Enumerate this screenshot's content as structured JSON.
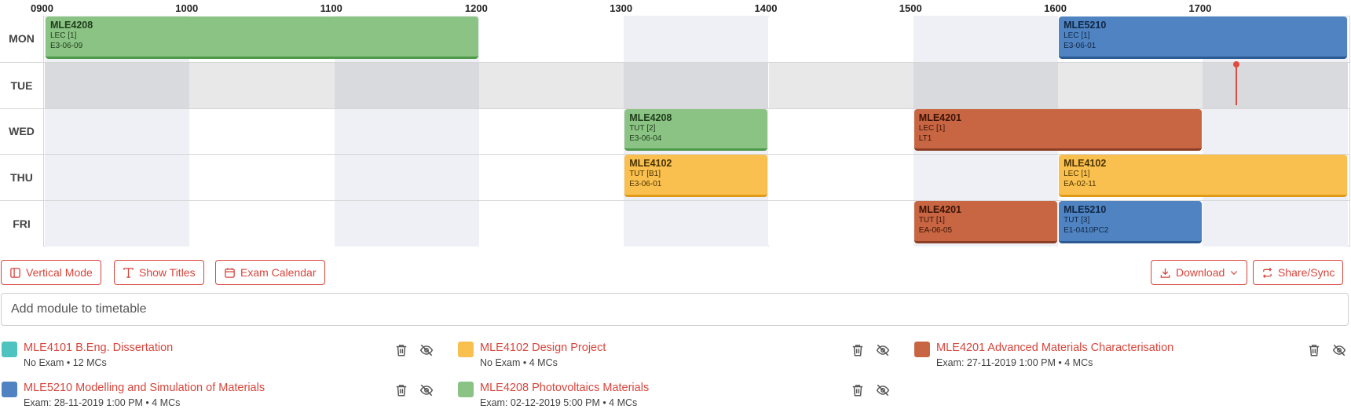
{
  "hours": [
    "0900",
    "1000",
    "1100",
    "1200",
    "1300",
    "1400",
    "1500",
    "1600",
    "1700"
  ],
  "days": [
    "MON",
    "TUE",
    "WED",
    "THU",
    "FRI"
  ],
  "colors": {
    "green": {
      "bg": "#8bc384",
      "border": "#4f9a4a",
      "text": "#1f3d1c"
    },
    "blue": {
      "bg": "#5083c1",
      "border": "#2c5a92",
      "text": "#0f2745"
    },
    "orange": {
      "bg": "#c86643",
      "border": "#8c3e24",
      "text": "#3a1305"
    },
    "yellow": {
      "bg": "#f9c04f",
      "border": "#e09a18",
      "text": "#4a3300"
    },
    "teal": {
      "bg": "#4fc3bf"
    },
    "accent": "#d7453c"
  },
  "lessons": [
    {
      "code": "MLE4208",
      "type": "LEC [1]",
      "venue": "E3-06-09",
      "day": 0,
      "start": 9,
      "end": 12,
      "color": "green"
    },
    {
      "code": "MLE5210",
      "type": "LEC [1]",
      "venue": "E3-06-01",
      "day": 0,
      "start": 16,
      "end": 18,
      "color": "blue"
    },
    {
      "code": "MLE4208",
      "type": "TUT [2]",
      "venue": "E3-06-04",
      "day": 2,
      "start": 13,
      "end": 14,
      "color": "green"
    },
    {
      "code": "MLE4201",
      "type": "LEC [1]",
      "venue": "LT1",
      "day": 2,
      "start": 15,
      "end": 17,
      "color": "orange"
    },
    {
      "code": "MLE4102",
      "type": "TUT [B1]",
      "venue": "E3-06-01",
      "day": 3,
      "start": 13,
      "end": 14,
      "color": "yellow"
    },
    {
      "code": "MLE4102",
      "type": "LEC [1]",
      "venue": "EA-02-11",
      "day": 3,
      "start": 16,
      "end": 18,
      "color": "yellow"
    },
    {
      "code": "MLE4201",
      "type": "TUT [1]",
      "venue": "EA-06-05",
      "day": 4,
      "start": 15,
      "end": 16,
      "color": "orange"
    },
    {
      "code": "MLE5210",
      "type": "TUT [3]",
      "venue": "E1-0410PC2",
      "day": 4,
      "start": 16,
      "end": 17,
      "color": "blue"
    }
  ],
  "now": {
    "day": 1,
    "hour": 17.23
  },
  "toolbar": {
    "vertical_mode": "Vertical Mode",
    "show_titles": "Show Titles",
    "exam_calendar": "Exam Calendar",
    "download": "Download",
    "share_sync": "Share/Sync"
  },
  "add_module": {
    "placeholder": "Add module to timetable"
  },
  "modules": [
    {
      "title": "MLE4101 B.Eng. Dissertation",
      "meta": "No Exam • 12 MCs",
      "color": "teal"
    },
    {
      "title": "MLE4102 Design Project",
      "meta": "No Exam • 4 MCs",
      "color": "yellow"
    },
    {
      "title": "MLE4201 Advanced Materials Characterisation",
      "meta": "Exam: 27-11-2019 1:00 PM • 4 MCs",
      "color": "orange"
    },
    {
      "title": "MLE5210 Modelling and Simulation of Materials",
      "meta": "Exam: 28-11-2019 1:00 PM • 4 MCs",
      "color": "blue"
    },
    {
      "title": "MLE4208 Photovoltaics Materials",
      "meta": "Exam: 02-12-2019 5:00 PM • 4 MCs",
      "color": "green"
    }
  ]
}
